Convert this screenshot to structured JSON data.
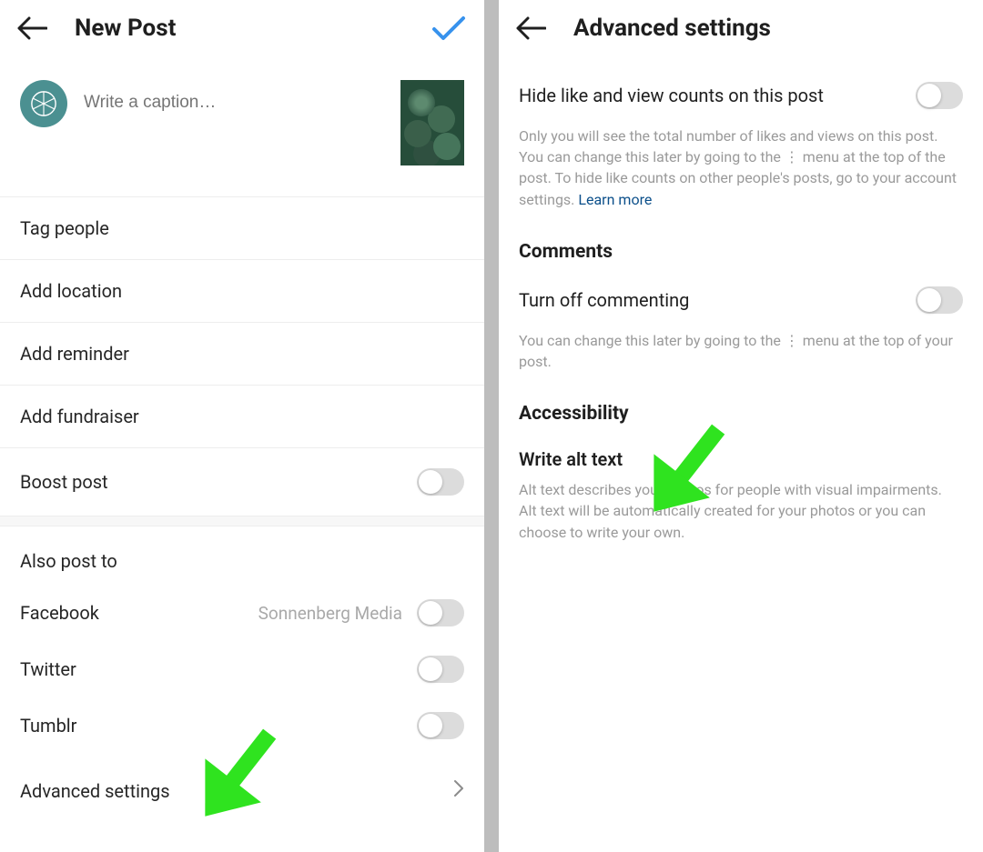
{
  "left": {
    "header_title": "New Post",
    "caption_placeholder": "Write a caption…",
    "menu": {
      "tag_people": "Tag people",
      "add_location": "Add location",
      "add_reminder": "Add reminder",
      "add_fundraiser": "Add fundraiser",
      "boost_post": "Boost post"
    },
    "also_post_to": "Also post to",
    "share": {
      "facebook": "Facebook",
      "facebook_account": "Sonnenberg Media",
      "twitter": "Twitter",
      "tumblr": "Tumblr"
    },
    "advanced_settings": "Advanced settings"
  },
  "right": {
    "header_title": "Advanced settings",
    "hide_counts_title": "Hide like and view counts on this post",
    "hide_counts_desc": "Only you will see the total number of likes and views on this post. You can change this later by going to the ⋮ menu at the top of the post. To hide like counts on other people's posts, go to your account settings. ",
    "learn_more": "Learn more",
    "comments_heading": "Comments",
    "turn_off_commenting": "Turn off commenting",
    "turn_off_desc": "You can change this later by going to the ⋮ menu at the top of your post.",
    "accessibility_heading": "Accessibility",
    "write_alt_text": "Write alt text",
    "alt_desc": "Alt text describes your photos for people with visual impairments. Alt text will be automatically created for your photos or you can choose to write your own."
  },
  "colors": {
    "accent_blue": "#3792ed",
    "link_blue": "#0b4f8a",
    "arrow_green": "#2fe31f"
  }
}
